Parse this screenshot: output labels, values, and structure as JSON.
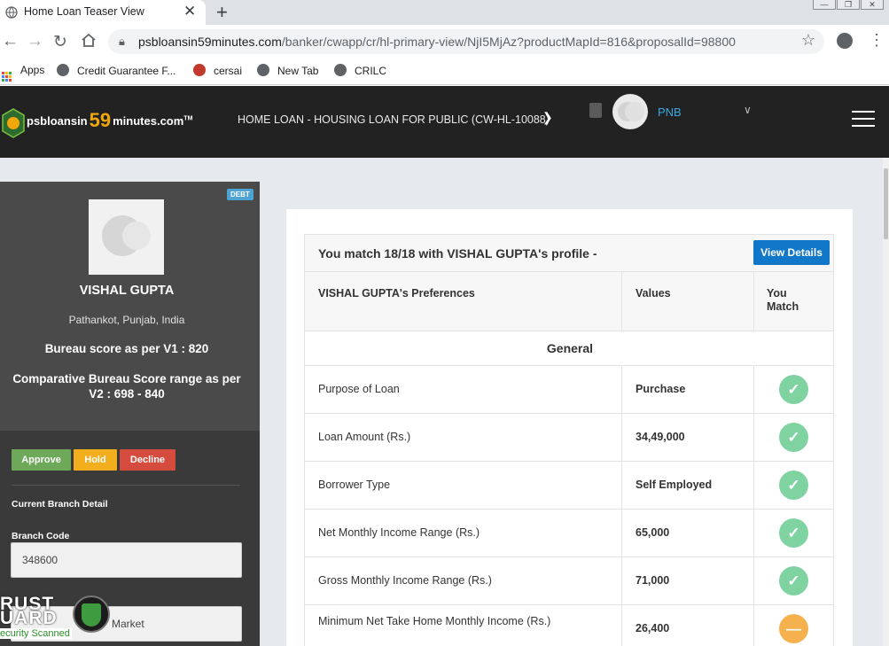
{
  "browser": {
    "tab_title": "Home Loan Teaser View",
    "url_host": "psbloansin59minutes.com",
    "url_path": "/banker/cwapp/cr/hl-primary-view/NjI5MjAz?productMapId=816&proposalId=98800",
    "bookmarks": [
      "Apps",
      "Credit Guarantee F...",
      "cersai",
      "New Tab",
      "CRILC"
    ]
  },
  "header": {
    "logo_prefix": "psbloansin",
    "logo_number": "59",
    "logo_suffix": "minutes.com",
    "logo_tm": "TM",
    "loan_title": "HOME LOAN - HOUSING LOAN FOR PUBLIC (CW-HL-10088)",
    "bank_name": "PNB"
  },
  "profile": {
    "badge": "DEBT",
    "name": "VISHAL GUPTA",
    "location": "Pathankot, Punjab, India",
    "bureau_v1": "Bureau score as per V1 : 820",
    "bureau_v2": "Comparative Bureau Score range as per V2 : 698 - 840",
    "actions": {
      "approve": "Approve",
      "hold": "Hold",
      "decline": "Decline"
    },
    "branch_section": "Current Branch Detail",
    "branch_code_label": "Branch Code",
    "branch_code_value": "348600",
    "branch_name_value": "Market"
  },
  "trust_seal": {
    "line1": "RUST",
    "line2": "UARD",
    "line3": "ecurity Scanned"
  },
  "match": {
    "summary": "You match 18/18 with VISHAL GUPTA's profile -",
    "view_details": "View Details",
    "columns": [
      "VISHAL GUPTA's Preferences",
      "Values",
      "You Match"
    ],
    "section": "General",
    "rows": [
      {
        "label": "Purpose of Loan",
        "value": "Purchase",
        "status": "match"
      },
      {
        "label": "Loan Amount (Rs.)",
        "value": "34,49,000",
        "status": "match"
      },
      {
        "label": "Borrower Type",
        "value": "Self Employed",
        "status": "match"
      },
      {
        "label": "Net Monthly Income Range (Rs.)",
        "value": "65,000",
        "status": "match"
      },
      {
        "label": "Gross Monthly Income Range (Rs.)",
        "value": "71,000",
        "status": "match"
      },
      {
        "label": "Minimum Net Take Home Monthly Income (Rs.)",
        "value": "26,400",
        "status": "partial"
      }
    ]
  },
  "colors": {
    "approve": "#6ea95a",
    "hold": "#f2ae1c",
    "decline": "#d54b3d",
    "match": "#7ed3a0",
    "partial": "#f6b14f",
    "accent": "#1177c8"
  }
}
